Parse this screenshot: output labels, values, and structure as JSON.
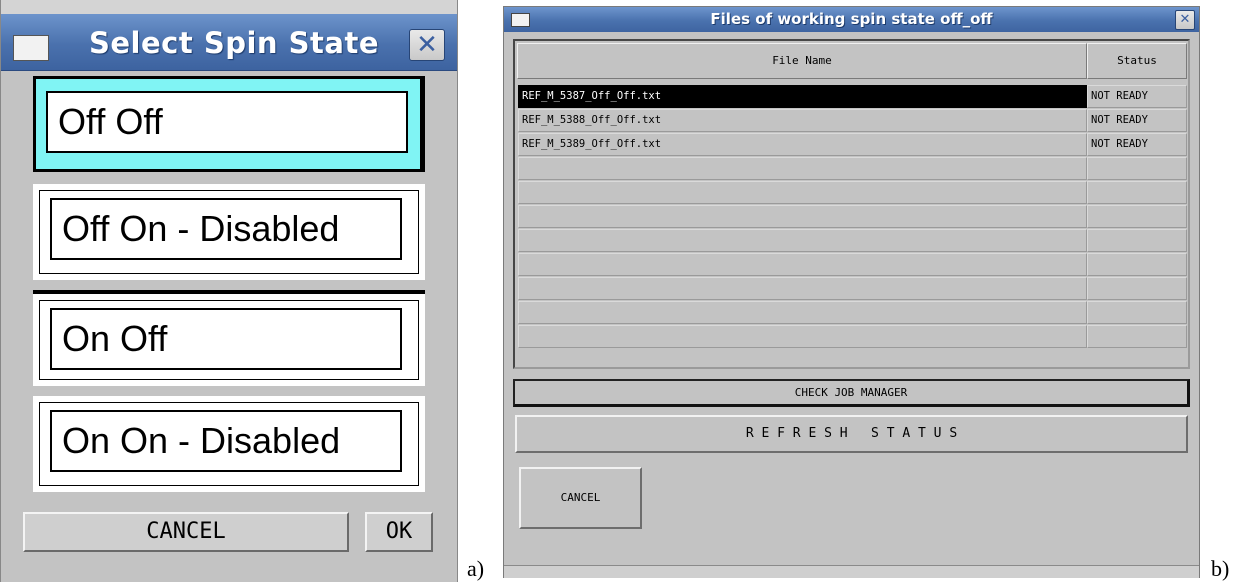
{
  "dialog_a": {
    "title": "Select Spin State",
    "close_glyph": "✕",
    "options": [
      "Off Off",
      "Off On - Disabled",
      "On Off",
      "On On - Disabled"
    ],
    "cancel_label": "CANCEL",
    "ok_label": "OK",
    "selected_option_color": "#80f4f4"
  },
  "dialog_b": {
    "title": "Files of working spin state off_off",
    "close_glyph": "✕",
    "columns": [
      "File Name",
      "Status"
    ],
    "rows": [
      {
        "file": "REF_M_5387_Off_Off.txt",
        "status": "NOT READY"
      },
      {
        "file": "REF_M_5388_Off_Off.txt",
        "status": "NOT READY"
      },
      {
        "file": "REF_M_5389_Off_Off.txt",
        "status": "NOT READY"
      },
      {
        "file": "",
        "status": ""
      },
      {
        "file": "",
        "status": ""
      },
      {
        "file": "",
        "status": ""
      },
      {
        "file": "",
        "status": ""
      },
      {
        "file": "",
        "status": ""
      },
      {
        "file": "",
        "status": ""
      },
      {
        "file": "",
        "status": ""
      },
      {
        "file": "",
        "status": ""
      }
    ],
    "check_job_label": "CHECK JOB MANAGER",
    "refresh_label": "R E F R E S H   S T A T U S",
    "cancel_label": "CANCEL"
  },
  "labels": {
    "a": "a)",
    "b": "b)"
  }
}
